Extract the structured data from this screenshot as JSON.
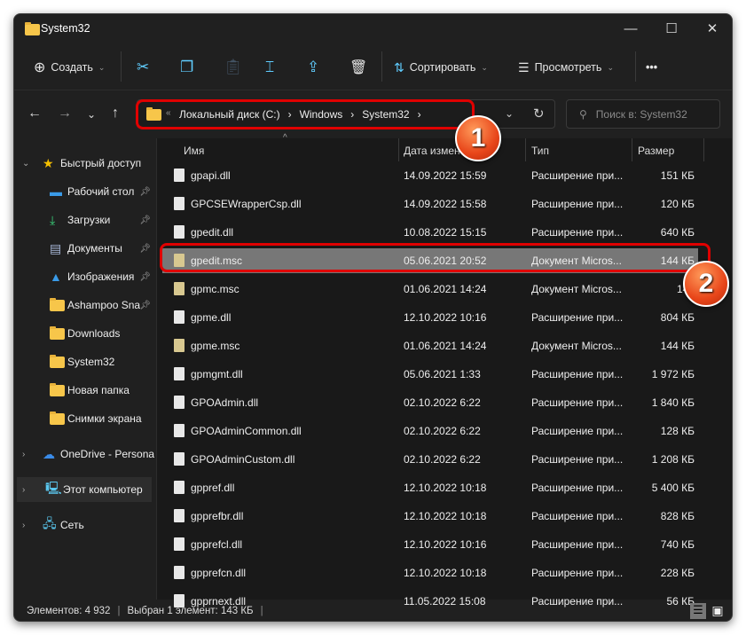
{
  "window": {
    "title": "System32"
  },
  "toolbar": {
    "create": "Создать",
    "sort": "Сортировать",
    "view": "Просмотреть",
    "more": "•••"
  },
  "address": {
    "path": [
      "Локальный диск (C:)",
      "Windows",
      "System32"
    ],
    "search_placeholder": "Поиск в: System32"
  },
  "sidebar": {
    "items": [
      {
        "label": "Быстрый доступ",
        "icon": "star-icon"
      },
      {
        "label": "Рабочий стол",
        "icon": "desktop-icon",
        "pinned": true
      },
      {
        "label": "Загрузки",
        "icon": "download-icon",
        "pinned": true
      },
      {
        "label": "Документы",
        "icon": "documents-icon",
        "pinned": true
      },
      {
        "label": "Изображения",
        "icon": "pictures-icon",
        "pinned": true
      },
      {
        "label": "Ashampoo Sna",
        "icon": "folder-icon",
        "pinned": true
      },
      {
        "label": "Downloads",
        "icon": "folder-icon"
      },
      {
        "label": "System32",
        "icon": "folder-icon"
      },
      {
        "label": "Новая папка",
        "icon": "folder-icon"
      },
      {
        "label": "Снимки экрана",
        "icon": "folder-icon"
      },
      {
        "label": "OneDrive - Personal",
        "icon": "cloud-icon"
      },
      {
        "label": "Этот компьютер",
        "icon": "computer-icon"
      },
      {
        "label": "Сеть",
        "icon": "network-icon"
      }
    ]
  },
  "columns": {
    "name": "Имя",
    "date": "Дата изменения",
    "type": "Тип",
    "size": "Размер"
  },
  "files": [
    {
      "name": "gpapi.dll",
      "date": "14.09.2022 15:59",
      "type": "Расширение при...",
      "size": "151 КБ"
    },
    {
      "name": "GPCSEWrapperCsp.dll",
      "date": "14.09.2022 15:58",
      "type": "Расширение при...",
      "size": "120 КБ"
    },
    {
      "name": "gpedit.dll",
      "date": "10.08.2022 15:15",
      "type": "Расширение при...",
      "size": "640 КБ"
    },
    {
      "name": "gpedit.msc",
      "date": "05.06.2021 20:52",
      "type": "Документ Micros...",
      "size": "144 КБ",
      "selected": true
    },
    {
      "name": "gpmc.msc",
      "date": "01.06.2021 14:24",
      "type": "Документ Micros...",
      "size": "144"
    },
    {
      "name": "gpme.dll",
      "date": "12.10.2022 10:16",
      "type": "Расширение при...",
      "size": "804 КБ"
    },
    {
      "name": "gpme.msc",
      "date": "01.06.2021 14:24",
      "type": "Документ Micros...",
      "size": "144 КБ"
    },
    {
      "name": "gpmgmt.dll",
      "date": "05.06.2021 1:33",
      "type": "Расширение при...",
      "size": "1 972 КБ"
    },
    {
      "name": "GPOAdmin.dll",
      "date": "02.10.2022 6:22",
      "type": "Расширение при...",
      "size": "1 840 КБ"
    },
    {
      "name": "GPOAdminCommon.dll",
      "date": "02.10.2022 6:22",
      "type": "Расширение при...",
      "size": "128 КБ"
    },
    {
      "name": "GPOAdminCustom.dll",
      "date": "02.10.2022 6:22",
      "type": "Расширение при...",
      "size": "1 208 КБ"
    },
    {
      "name": "gppref.dll",
      "date": "12.10.2022 10:18",
      "type": "Расширение при...",
      "size": "5 400 КБ"
    },
    {
      "name": "gpprefbr.dll",
      "date": "12.10.2022 10:18",
      "type": "Расширение при...",
      "size": "828 КБ"
    },
    {
      "name": "gpprefcl.dll",
      "date": "12.10.2022 10:16",
      "type": "Расширение при...",
      "size": "740 КБ"
    },
    {
      "name": "gpprefcn.dll",
      "date": "12.10.2022 10:18",
      "type": "Расширение при...",
      "size": "228 КБ"
    },
    {
      "name": "gpprnext.dll",
      "date": "11.05.2022 15:08",
      "type": "Расширение при...",
      "size": "56 КБ"
    }
  ],
  "status": {
    "count": "Элементов: 4 932",
    "selection": "Выбран 1 элемент: 143 КБ"
  },
  "annotations": {
    "badge1": "1",
    "badge2": "2",
    "color": "#e00000"
  }
}
